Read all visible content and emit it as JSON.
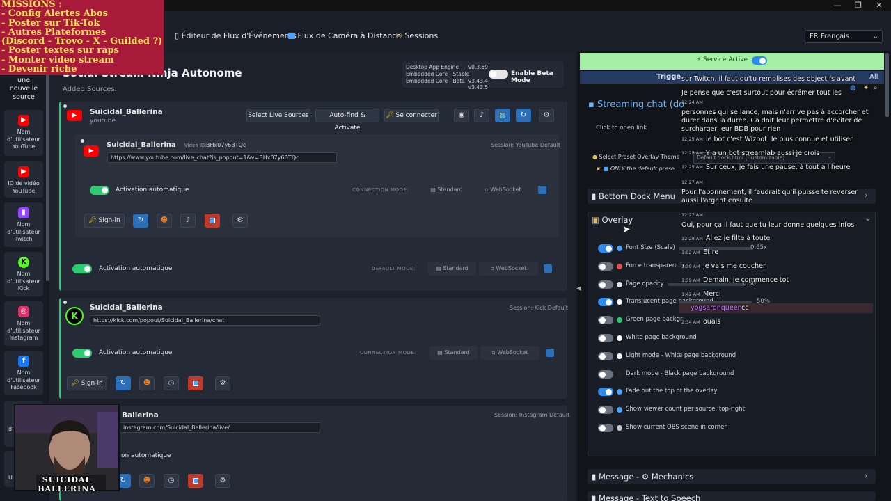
{
  "window": {
    "min_icon": "minimize-icon",
    "restore_icon": "restore-icon",
    "close_icon": "close-icon"
  },
  "overlay_text": {
    "missions": [
      "MISSIONS :",
      "- Config Alertes Abos",
      "- Poster sur Tik-Tok",
      "- Autres Plateformes",
      "(Discord - Trovo - X - Guilded ?)",
      "- Poster textes sur raps",
      "- Monter video stream",
      "- Devenir riche"
    ]
  },
  "nav": {
    "tabs": [
      {
        "label": "Éditeur de Flux d'Événements",
        "icon": "square-icon"
      },
      {
        "label": "Flux de Caméra à Distance",
        "icon": "camera-icon"
      },
      {
        "label": "Sessions",
        "icon": "users-icon"
      }
    ],
    "language": "FR Français"
  },
  "sidebar": {
    "add_source": "une nouvelle source",
    "items": [
      {
        "label": "Nom d'utilisateur YouTube",
        "icon": "youtube-icon",
        "color": "#ff0000"
      },
      {
        "label": "ID de vidéo YouTube",
        "icon": "youtube-icon",
        "color": "#ff0000"
      },
      {
        "label": "Nom d'utilisateur Twitch",
        "icon": "twitch-icon",
        "color": "#9146ff"
      },
      {
        "label": "Nom d'utilisateur Kick",
        "icon": "kick-icon",
        "color": "#53fc18"
      },
      {
        "label": "Nom d'utilisateur Instagram",
        "icon": "instagram-icon",
        "color": "#e1306c"
      },
      {
        "label": "Nom d'utilisateur Facebook",
        "icon": "facebook-icon",
        "color": "#1877f2"
      }
    ],
    "partial_labels": [
      "d'",
      "U"
    ]
  },
  "main": {
    "title": "Social Stream Ninja Autonome",
    "added_sources": "Added Sources:",
    "version_box": {
      "lines": [
        {
          "name": "Desktop App Engine",
          "ver": "v0.3.69"
        },
        {
          "name": "Embedded Core - Stable",
          "ver": "v3.43.4"
        },
        {
          "name": "Embedded Core - Beta",
          "ver": "v3.43.5"
        }
      ],
      "beta_label": "Enable Beta Mode"
    },
    "youtube": {
      "name": "Suicidal_Ballerina",
      "type": "youtube",
      "buttons": {
        "select": "Select Live Sources",
        "autofind": "Auto-find & Activate",
        "connect": "Se connecter"
      },
      "sub": {
        "name": "Suicidal_Ballerina",
        "video_id_label": "Video ID:",
        "video_id": "BHx07y6BTQc",
        "url": "https://www.youtube.com/live_chat?is_popout=1&v=BHx07y6BTQc",
        "session": "Session: YouTube Default",
        "auto": "Activation automatique",
        "mode_label": "CONNECTION MODE:",
        "mode_a": "Standard",
        "mode_b": "WebSocket",
        "signin": "Sign-in"
      },
      "auto": "Activation automatique",
      "mode_label": "DEFAULT MODE:",
      "mode_a": "Standard",
      "mode_b": "WebSocket"
    },
    "kick": {
      "name": "Suicidal_Ballerina",
      "url": "https://kick.com/popout/Suicidal_Ballerina/chat",
      "session": "Session: Kick Default",
      "auto": "Activation automatique",
      "mode_label": "CONNECTION MODE:",
      "mode_a": "Standard",
      "mode_b": "WebSocket",
      "signin": "Sign-in"
    },
    "instagram": {
      "name_partial": "Ballerina",
      "url_partial": "instagram.com/Suicidal_Ballerina/live/",
      "session": "Session: Instagram Default",
      "auto_partial": "on automatique"
    }
  },
  "right": {
    "service": "Service Active",
    "trigger": "Trigge",
    "trigger_end": "All",
    "streaming_chat": "Streaming chat (do",
    "click_open": "Click to open link",
    "preset_label": "Select Preset Overlay Theme",
    "preset_value": "Default dock.html (Customizable)",
    "only_default": "ONLY the default prese",
    "bottom_dock": "Bottom Dock Menu",
    "overlay": "Overlay",
    "rows": [
      {
        "label": "Font Size (Scale)",
        "on": true,
        "value": "0.65x",
        "icon": "font-icon"
      },
      {
        "label": "Force transparent b",
        "on": false,
        "icon": "circle-icon"
      },
      {
        "label": "Page opacity",
        "on": false,
        "value": "0.50",
        "icon": "opacity-icon"
      },
      {
        "label": "Translucent page background",
        "on": true,
        "value": "50%",
        "icon": "dot-icon"
      },
      {
        "label": "Green page backgr",
        "on": false,
        "icon": "green-dot-icon"
      },
      {
        "label": "White page background",
        "on": false,
        "icon": "white-dot-icon"
      },
      {
        "label": "Light mode - White page background",
        "on": false,
        "icon": "white-dot-icon"
      },
      {
        "label": "Dark mode - Black page background",
        "on": false,
        "icon": "black-dot-icon"
      },
      {
        "label": "Fade out the top of the overlay",
        "on": true,
        "icon": "fade-icon"
      },
      {
        "label": "Show viewer count per source; top-right",
        "on": false,
        "icon": "viewer-icon"
      },
      {
        "label": "Show current OBS scene in corner",
        "on": false,
        "icon": "obs-icon"
      }
    ],
    "message_mechanics": "Message - ⚙ Mechanics",
    "message_tts": "Message - Text to Speech"
  },
  "chat_overlay": [
    {
      "time": "",
      "text": "sur Twitch, il faut qu'tu remplises des objectifs avant"
    },
    {
      "time": "12:24 AM",
      "text": "Je pense que c'est surtout pour écrémer tout les"
    },
    {
      "time": "",
      "text": "personnes qui se lance, mais n'arrive pas à accorcher et"
    },
    {
      "time": "",
      "text": "durer dans la durée. Ca doit leur permettre d'éviter de"
    },
    {
      "time": "",
      "text": "surcharger leur BDB pour rien"
    },
    {
      "time": "12:25 AM",
      "text": "le bot c'est Wizbot, le plus connue et utiliser"
    },
    {
      "time": "12:25 AM",
      "text": "Y a un bot streamlab aussi je crois"
    },
    {
      "time": "12:25 AM",
      "text": "Sur ceux, je fais une pause, à tout à l'heure"
    },
    {
      "time": "12:27 AM",
      "text": ""
    },
    {
      "time": "",
      "text": "Pour l'abonnement, il faudrait qu'il puisse te reverser"
    },
    {
      "time": "",
      "text": "aussi l'argent ensuite"
    },
    {
      "time": "12:27 AM",
      "text": ""
    },
    {
      "time": "",
      "text": "Oui, pour ça il faut que tu leur donne quelques infos"
    },
    {
      "time": "12:28 AM",
      "text": "Allez je filte à toute"
    },
    {
      "time": "1:02 AM",
      "text": "Et re"
    },
    {
      "time": "1:39 AM",
      "text": "Je vais me coucher"
    },
    {
      "time": "1:39 AM",
      "text": "Demain, je commence tot"
    },
    {
      "time": "1:42 AM",
      "text": "Merci"
    },
    {
      "time": "2:33 AM",
      "text": "cc",
      "user": "yogsaronqueen"
    },
    {
      "time": "2:34 AM",
      "text": "ouais"
    }
  ],
  "webcam": {
    "name": "SUICIDAL BALLERINA"
  }
}
